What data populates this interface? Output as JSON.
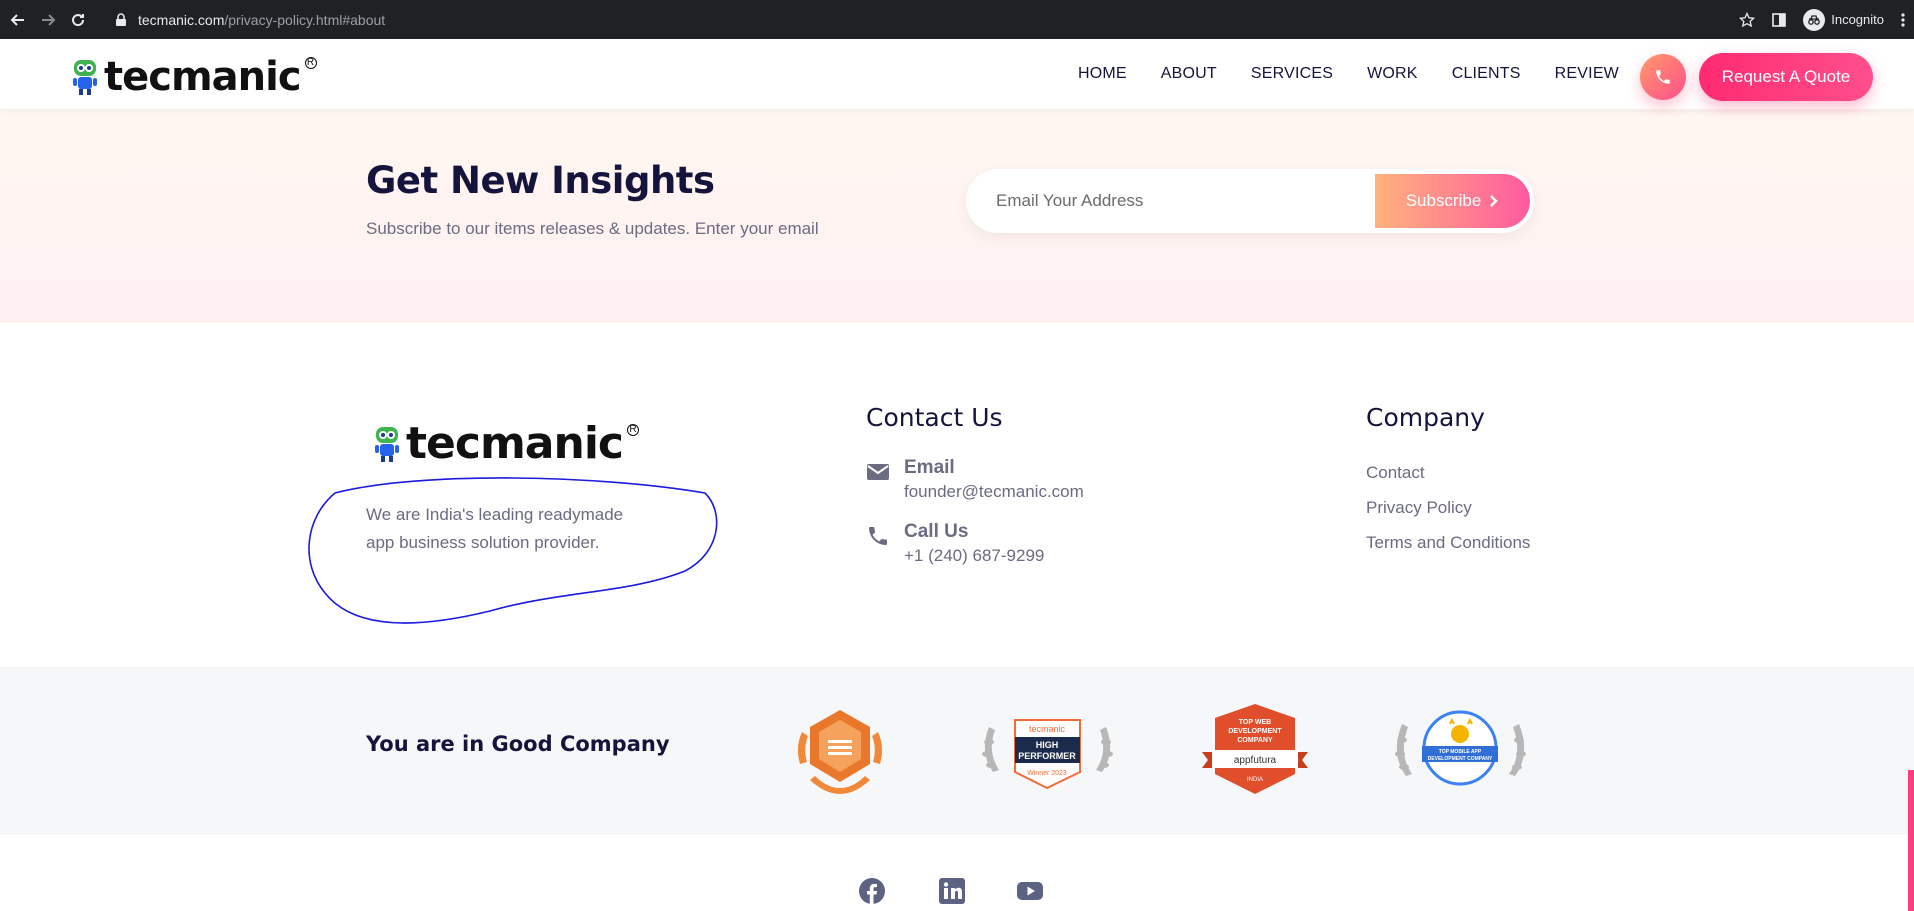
{
  "browser": {
    "url_host": "tecmanic.com",
    "url_path": "/privacy-policy.html#about",
    "incognito_label": "Incognito"
  },
  "header": {
    "logo_text": "tecmanic",
    "logo_mark": "R",
    "nav": [
      "HOME",
      "ABOUT",
      "SERVICES",
      "WORK",
      "CLIENTS",
      "REVIEW"
    ],
    "quote_button": "Request A Quote"
  },
  "insights": {
    "title": "Get New Insights",
    "subtitle": "Subscribe to our items releases & updates. Enter your email",
    "email_placeholder": "Email Your Address",
    "subscribe_label": "Subscribe"
  },
  "footer": {
    "logo_text": "tecmanic",
    "logo_mark": "R",
    "about_line1": "We are India's leading readymade",
    "about_line2": "app business solution provider.",
    "contact_title": "Contact Us",
    "email_label": "Email",
    "email_value": "founder@tecmanic.com",
    "call_label": "Call Us",
    "call_value": "+1 (240) 687-9299",
    "company_title": "Company",
    "company_links": [
      "Contact",
      "Privacy Policy",
      "Terms and Conditions"
    ]
  },
  "good_company": {
    "title": "You are in Good Company",
    "badges": [
      {
        "name": "hexagon-award-badge"
      },
      {
        "name": "high-performer-badge",
        "brand": "tecmanic",
        "line1": "HIGH",
        "line2": "PERFORMER",
        "year": "Winner 2023"
      },
      {
        "name": "appfutura-badge",
        "line1": "TOP WEB",
        "line2": "DEVELOPMENT",
        "line3": "COMPANY",
        "brand": "appfutura",
        "country": "INDIA"
      },
      {
        "name": "top-mobile-app-badge",
        "line1": "TOP MOBILE APP",
        "line2": "DEVELOPMENT COMPANY"
      }
    ]
  },
  "social": [
    "facebook-icon",
    "linkedin-icon",
    "youtube-icon"
  ],
  "colors": {
    "navy": "#14143c",
    "pink": "#ff2a72",
    "gray_text": "#6b6b82",
    "scribble": "#1a1ae0"
  }
}
